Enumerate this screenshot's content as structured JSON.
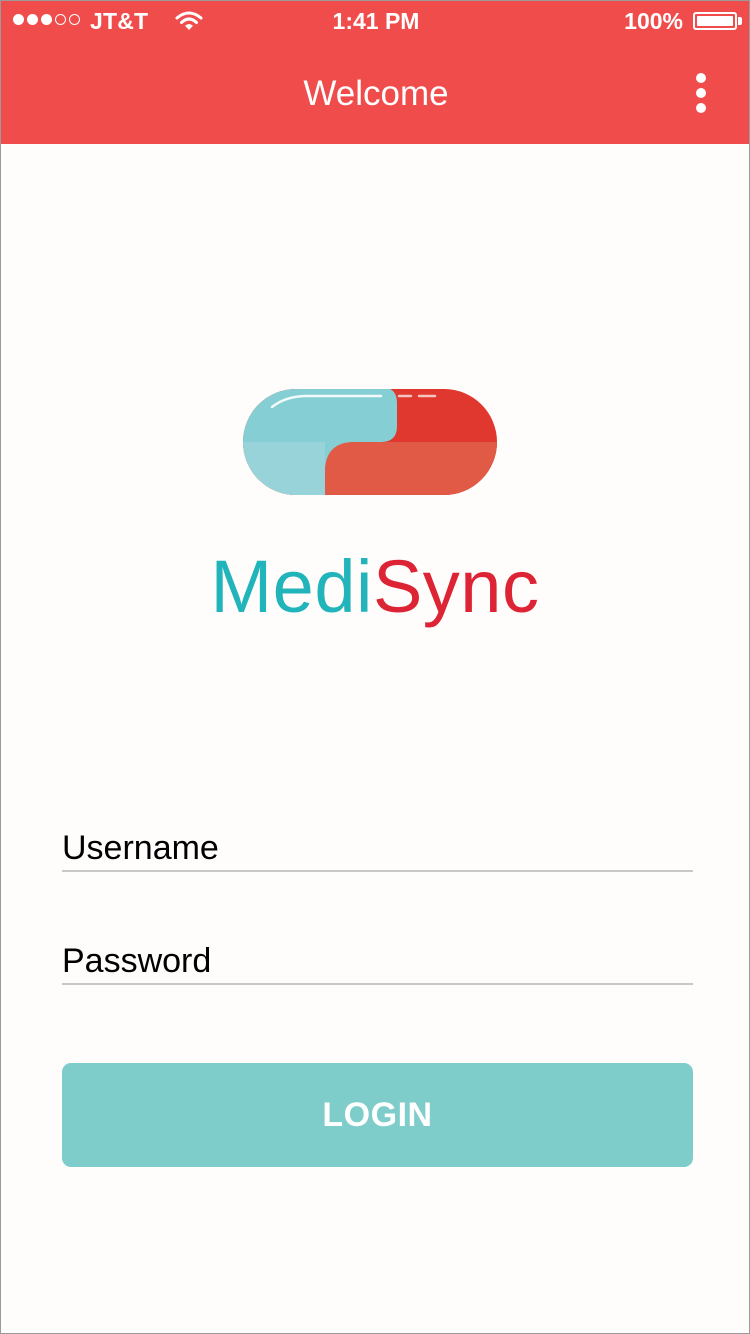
{
  "status_bar": {
    "signal_dots_full": 3,
    "signal_dots_total": 5,
    "carrier": "JT&T",
    "time": "1:41 PM",
    "battery_percent": "100%",
    "battery_level": 1.0,
    "icons": [
      "signal-dots",
      "wifi-icon",
      "battery-icon"
    ]
  },
  "nav": {
    "title": "Welcome",
    "menu_icon": "more-vertical-icon",
    "color": "#f14c4c"
  },
  "logo": {
    "brand_part1": "Medi",
    "brand_part2": "Sync",
    "brand_color1": "#22b4bb",
    "brand_color2": "#dd2435",
    "pill_icon": "capsule-logo-icon"
  },
  "form": {
    "username_placeholder": "Username",
    "password_placeholder": "Password",
    "login_label": "LOGIN",
    "login_color": "#7ecdca"
  }
}
